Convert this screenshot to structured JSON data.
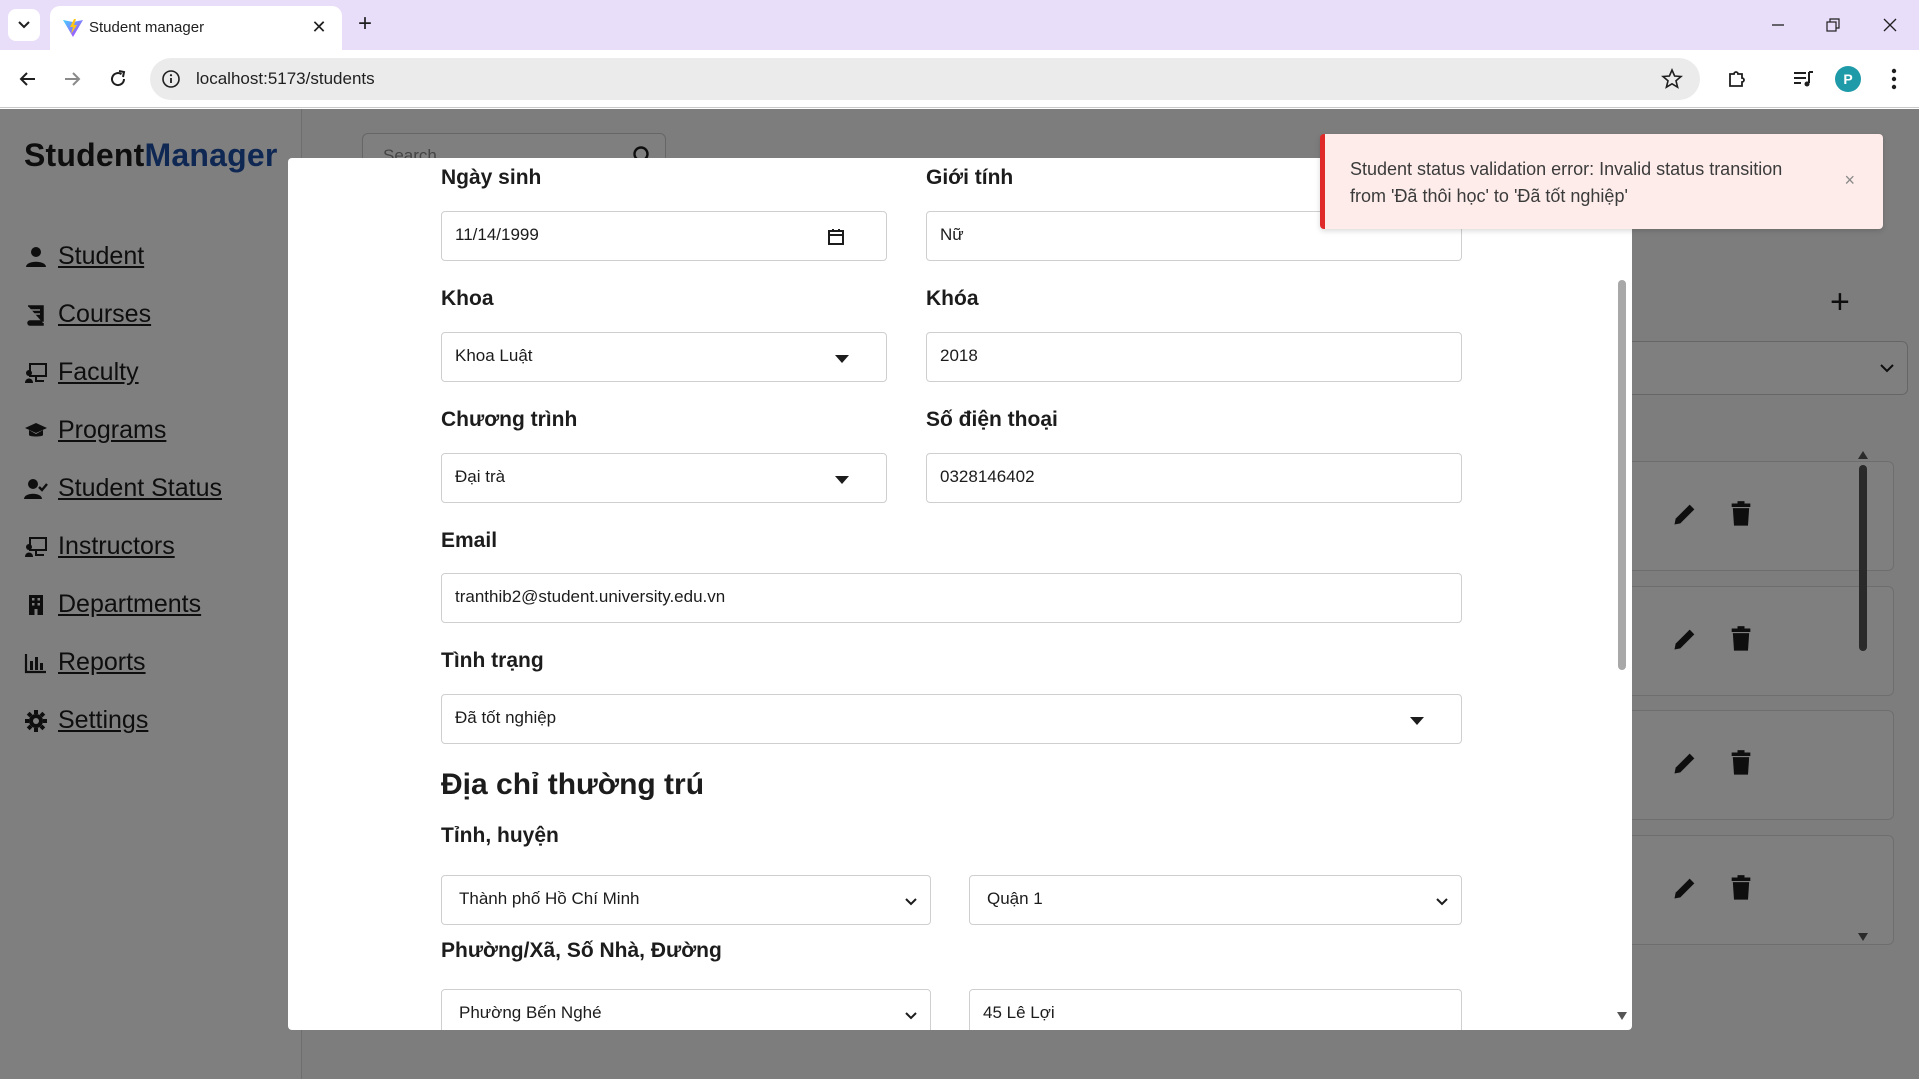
{
  "browser": {
    "tab_title": "Student manager",
    "url": "localhost:5173/students",
    "profile_initial": "P"
  },
  "app": {
    "brand_part1": "Student",
    "brand_part2": "Manager",
    "search_placeholder": "Search",
    "nav": [
      {
        "label": "Student",
        "icon": "user-icon"
      },
      {
        "label": "Courses",
        "icon": "book-icon"
      },
      {
        "label": "Faculty",
        "icon": "chalkboard-icon"
      },
      {
        "label": "Programs",
        "icon": "graduation-cap-icon"
      },
      {
        "label": "Student Status",
        "icon": "user-check-icon"
      },
      {
        "label": "Instructors",
        "icon": "chalkboard-teacher-icon"
      },
      {
        "label": "Departments",
        "icon": "building-icon"
      },
      {
        "label": "Reports",
        "icon": "bar-chart-icon"
      },
      {
        "label": "Settings",
        "icon": "gear-icon"
      }
    ]
  },
  "form": {
    "dob_label": "Ngày sinh",
    "dob_value": "11/14/1999",
    "gender_label": "Giới tính",
    "gender_value": "Nữ",
    "faculty_label": "Khoa",
    "faculty_value": "Khoa Luật",
    "cohort_label": "Khóa",
    "cohort_value": "2018",
    "program_label": "Chương trình",
    "program_value": "Đại trà",
    "phone_label": "Số điện thoại",
    "phone_value": "0328146402",
    "email_label": "Email",
    "email_value": "tranthib2@student.university.edu.vn",
    "status_label": "Tình trạng",
    "status_value": "Đã tốt nghiệp",
    "address_title": "Địa chỉ thường trú",
    "province_label": "Tỉnh, huyện",
    "province_value": "Thành phố Hồ Chí Minh",
    "district_value": "Quận 1",
    "ward_label": "Phường/Xã, Số Nhà, Đường",
    "ward_value": "Phường Bến Nghé",
    "street_value": "45 Lê Lợi"
  },
  "toast": {
    "message": "Student status validation error: Invalid status transition from 'Đã thôi học' to 'Đã tốt nghiệp'",
    "close": "×"
  },
  "colors": {
    "brand_accent": "#1f4fa6",
    "toast_border": "#e02a2a",
    "toast_bg": "#fdecea",
    "tabbar_bg": "#e9defa"
  }
}
